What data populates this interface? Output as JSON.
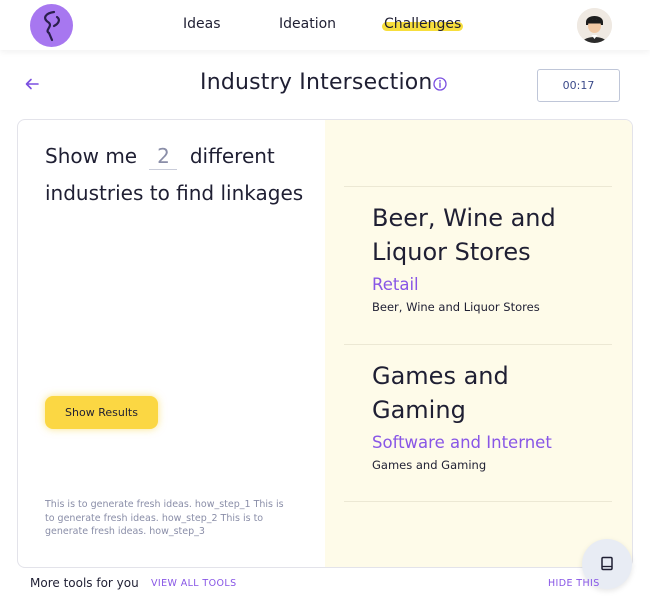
{
  "nav": {
    "logo_icon": "lightning-logo-icon",
    "links": [
      "Ideas",
      "Ideation",
      "Challenges"
    ],
    "active": "Challenges",
    "avatar_icon": "user-avatar"
  },
  "header": {
    "back_icon": "arrow-left-icon",
    "title": "Industry Intersection",
    "info_icon": "info-circle-icon",
    "timer": "00:17"
  },
  "left": {
    "prompt_prefix": "Show me",
    "count": "2",
    "prompt_suffix": "different industries to find linkages",
    "button": "Show Results",
    "help_text": "This is to generate fresh ideas. how_step_1 This is to generate fresh ideas. how_step_2 This is to generate fresh ideas. how_step_3"
  },
  "results": [
    {
      "name": "Beer, Wine and Liquor Stores",
      "category": "Retail",
      "subcategory": "Beer, Wine and Liquor Stores"
    },
    {
      "name": "Games and Gaming",
      "category": "Software and Internet",
      "subcategory": "Games and Gaming"
    }
  ],
  "footer": {
    "more_tools": "More tools for you",
    "view_all": "VIEW ALL TOOLS",
    "hide": "HIDE THIS",
    "book_icon": "book-icon"
  },
  "colors": {
    "accent": "#8856e6",
    "highlight": "#f7de3c",
    "right_pane_bg": "#fefbe9",
    "button": "#fbd743"
  }
}
